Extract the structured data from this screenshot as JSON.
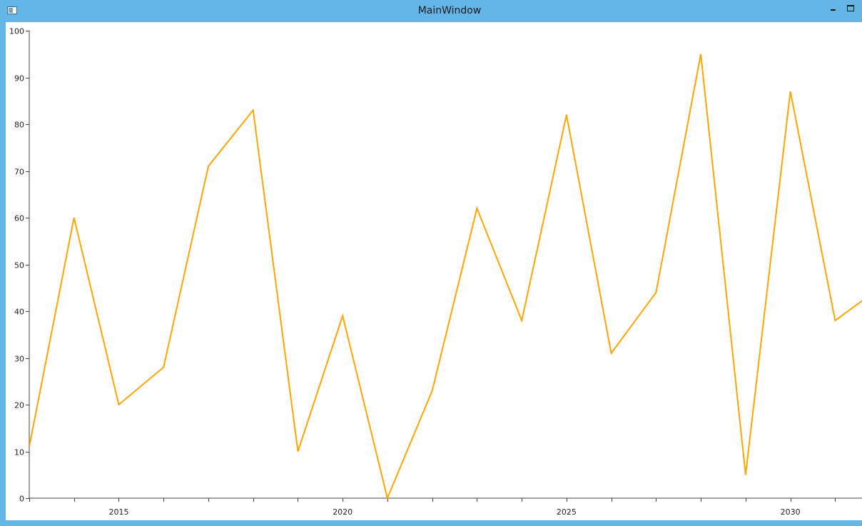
{
  "window": {
    "title": "MainWindow"
  },
  "chart_data": {
    "type": "line",
    "x": [
      2013,
      2014,
      2015,
      2016,
      2017,
      2018,
      2019,
      2020,
      2021,
      2022,
      2023,
      2024,
      2025,
      2026,
      2027,
      2028,
      2029,
      2030,
      2031,
      2032
    ],
    "series": [
      {
        "values": [
          11,
          60,
          20,
          28,
          71,
          83,
          10,
          39,
          0,
          23,
          62,
          38,
          82,
          31,
          44,
          95,
          5,
          87,
          38,
          45
        ],
        "color": "#ffa500"
      }
    ],
    "xlim": [
      2013,
      2031.6
    ],
    "ylim": [
      0,
      100
    ],
    "xticks": [
      2015,
      2020,
      2025,
      2030
    ],
    "yticks": [
      0,
      10,
      20,
      30,
      40,
      50,
      60,
      70,
      80,
      90,
      100
    ],
    "grid": false
  }
}
